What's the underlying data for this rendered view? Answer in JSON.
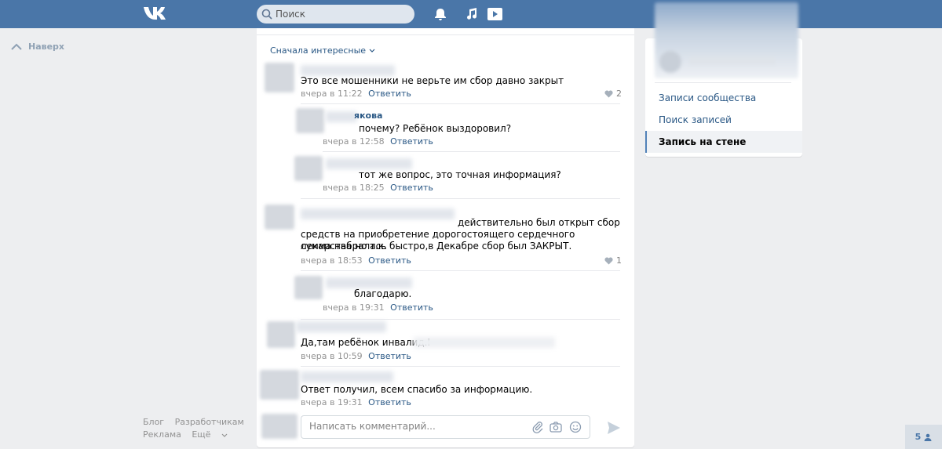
{
  "header": {
    "search_placeholder": "Поиск",
    "brand_color": "#4a76a8"
  },
  "left": {
    "up_label": "Наверх"
  },
  "main": {
    "sort_label": "Сначала интересные",
    "comments": [
      {
        "text": "Это все мошенники не верьте им сбор давно закрыт",
        "time": "вчера в 11:22",
        "reply": "Ответить",
        "likes": "2"
      },
      {
        "name_fragment": "якова",
        "text": "почему? Ребёнок выздоровил?",
        "time": "вчера в 12:58",
        "reply": "Ответить"
      },
      {
        "text": "тот же вопрос, это точная информация?",
        "time": "вчера в 18:25",
        "reply": "Ответить"
      },
      {
        "text_line1": "действительно был открыт сбор",
        "text_line2": "средств на приобретение дорогостоящего сердечного лекарства,но т.к.",
        "text_line3": "сумма набралась быстро,в Декабре сбор был ЗАКРЫТ.",
        "time": "вчера в 18:53",
        "reply": "Ответить",
        "likes": "1"
      },
      {
        "text": "благодарю.",
        "time": "вчера в 19:31",
        "reply": "Ответить"
      },
      {
        "text": "Да,там ребёнок инвалид.I",
        "time": "вчера в 10:59",
        "reply": "Ответить"
      },
      {
        "text": "Ответ получил, всем спасибо за информацию.",
        "time": "вчера в 19:31",
        "reply": "Ответить"
      }
    ],
    "comment_placeholder": "Написать комментарий..."
  },
  "right": {
    "nav": [
      "Записи сообщества",
      "Поиск записей",
      "Запись на стене"
    ]
  },
  "footer": {
    "links_row1": [
      "Блог",
      "Разработчикам"
    ],
    "links_row2": [
      "Реклама",
      "Ещё"
    ]
  },
  "badge": {
    "count": "5"
  }
}
